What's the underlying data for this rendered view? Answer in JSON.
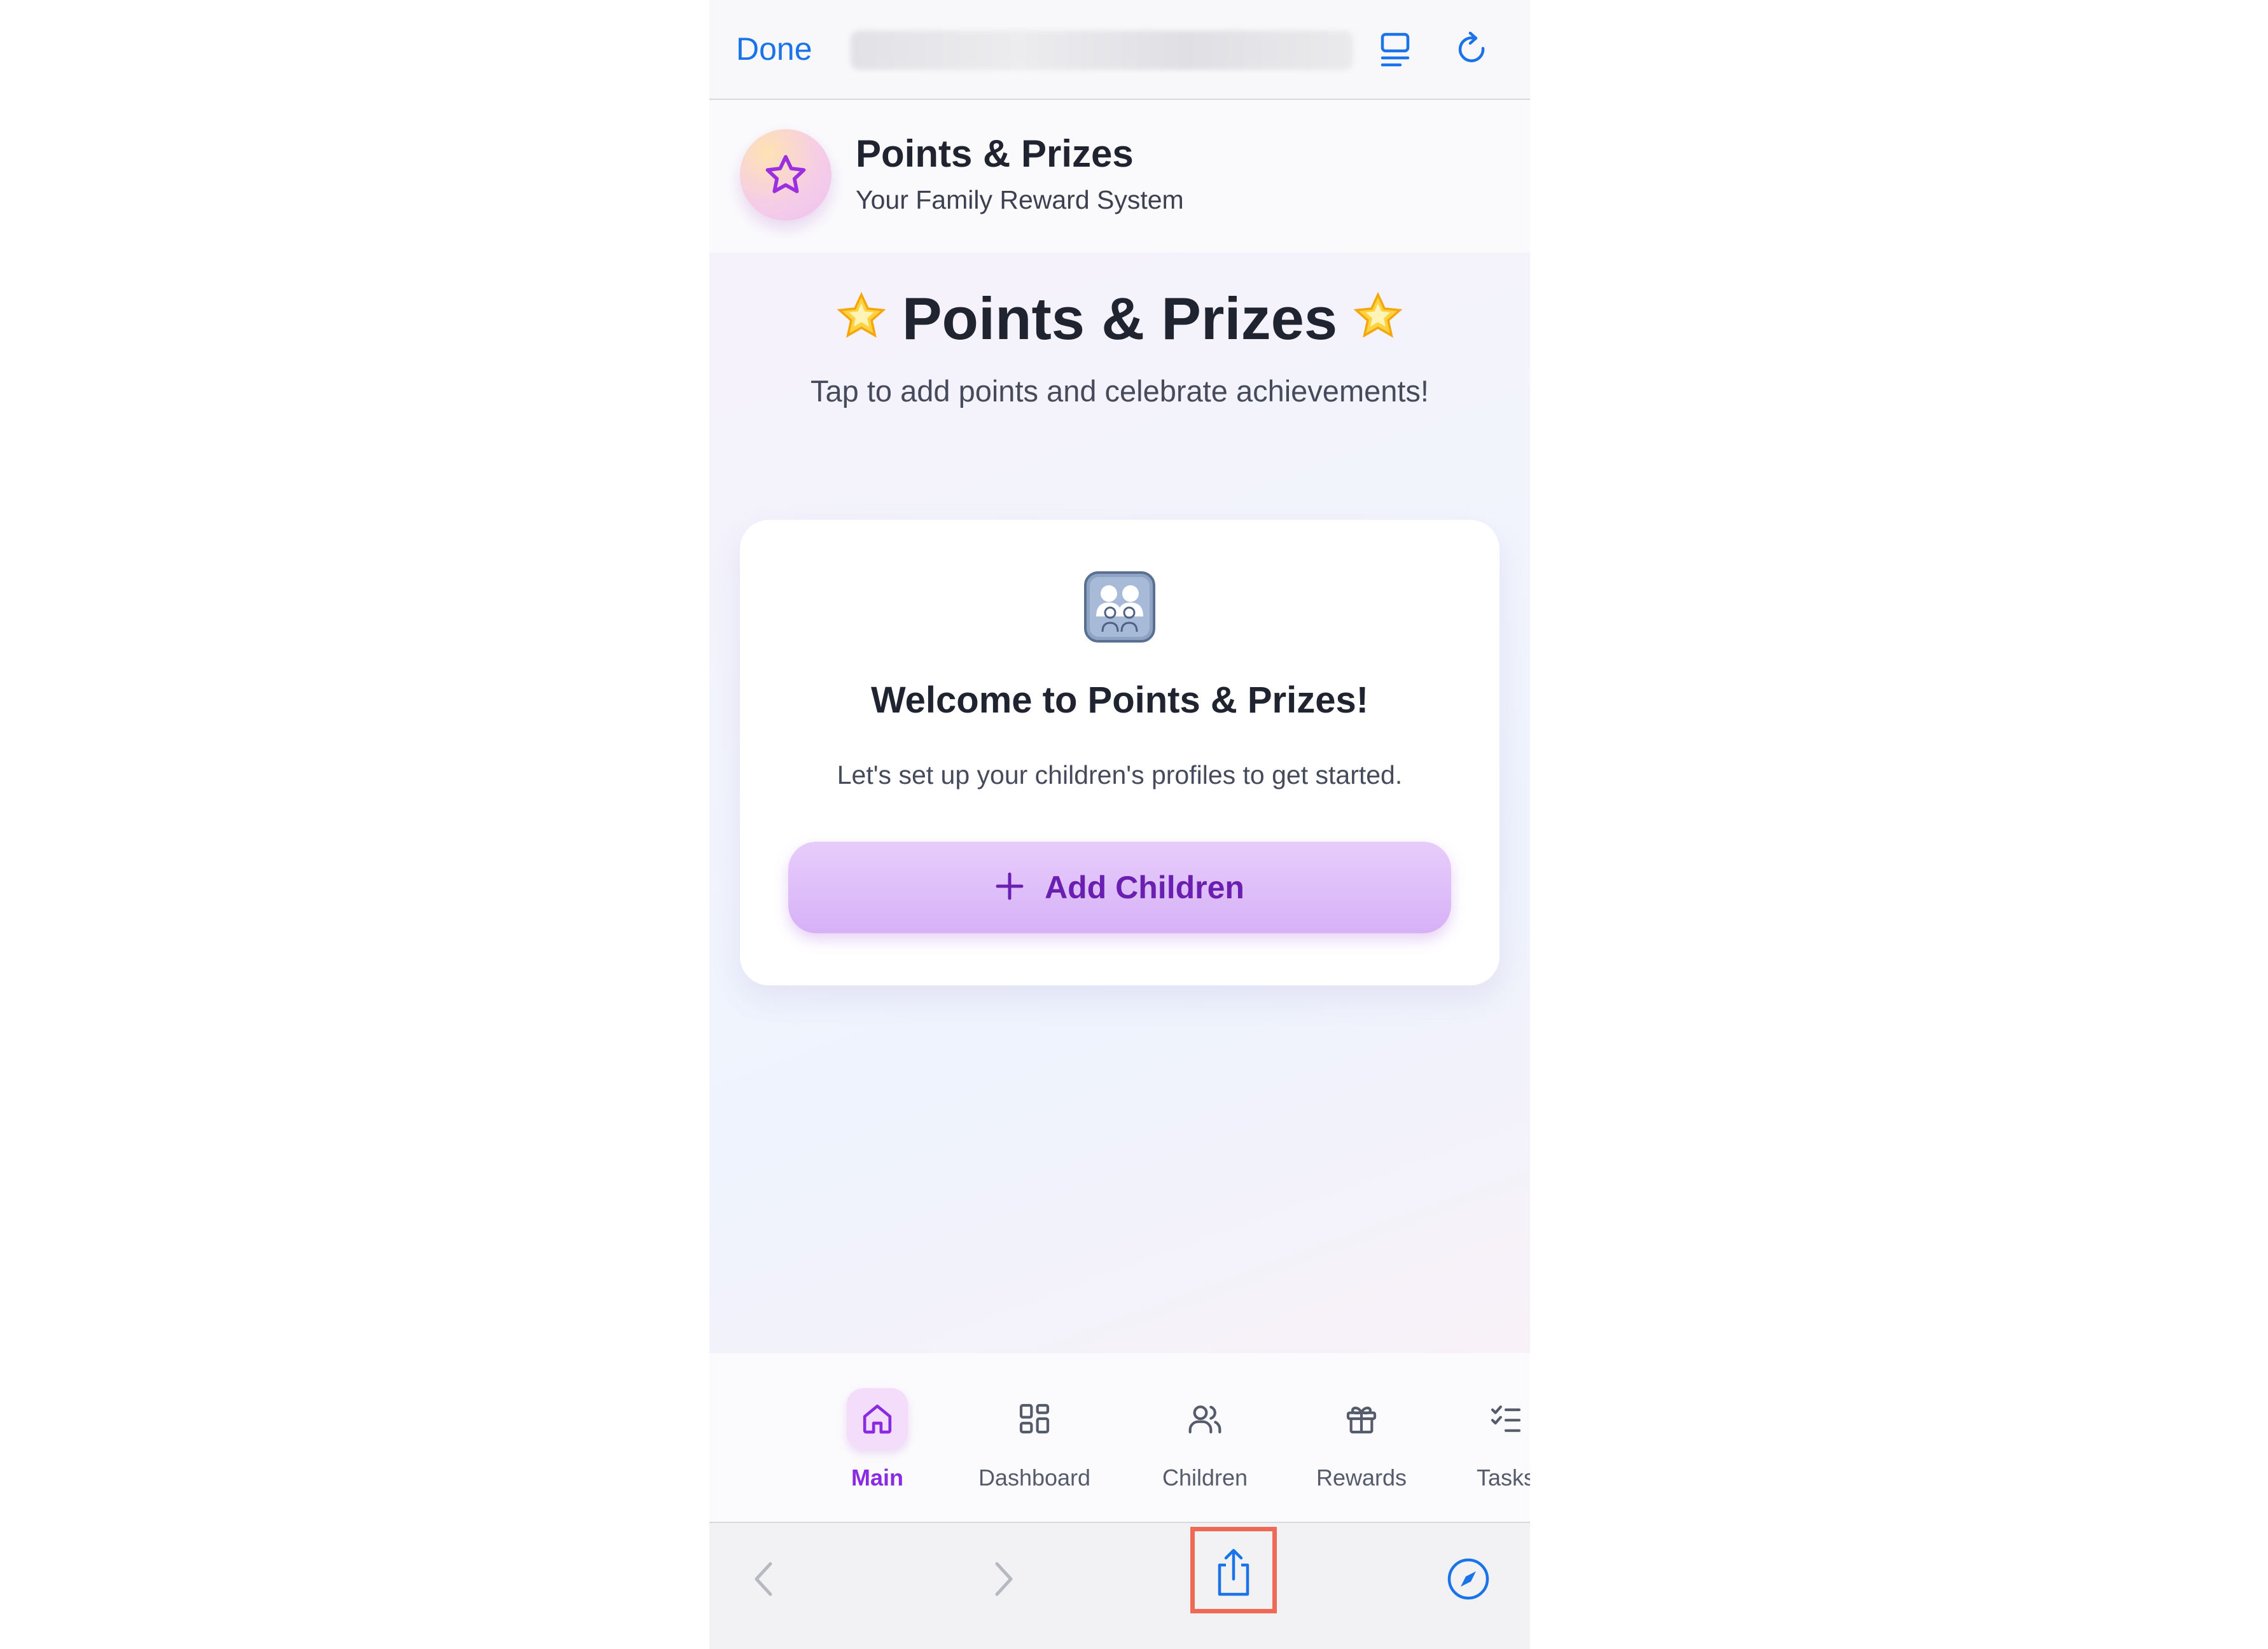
{
  "browser": {
    "done_label": "Done"
  },
  "app_header": {
    "title": "Points & Prizes",
    "subtitle": "Your Family Reward System"
  },
  "hero": {
    "title": "Points & Prizes",
    "subtitle": "Tap to add points and celebrate achievements!"
  },
  "welcome_card": {
    "title": "Welcome to Points & Prizes!",
    "text": "Let's set up your children's profiles to get started.",
    "button_label": "Add Children"
  },
  "nav": {
    "items": [
      {
        "label": "Main",
        "icon": "home-icon",
        "active": true
      },
      {
        "label": "Dashboard",
        "icon": "grid-icon",
        "active": false
      },
      {
        "label": "Children",
        "icon": "users-icon",
        "active": false
      },
      {
        "label": "Rewards",
        "icon": "gift-icon",
        "active": false
      },
      {
        "label": "Tasks",
        "icon": "checklist-icon",
        "active": false
      }
    ]
  },
  "colors": {
    "accent": "#8a2be2",
    "link": "#1a73e8",
    "highlight": "#ee6a55"
  }
}
